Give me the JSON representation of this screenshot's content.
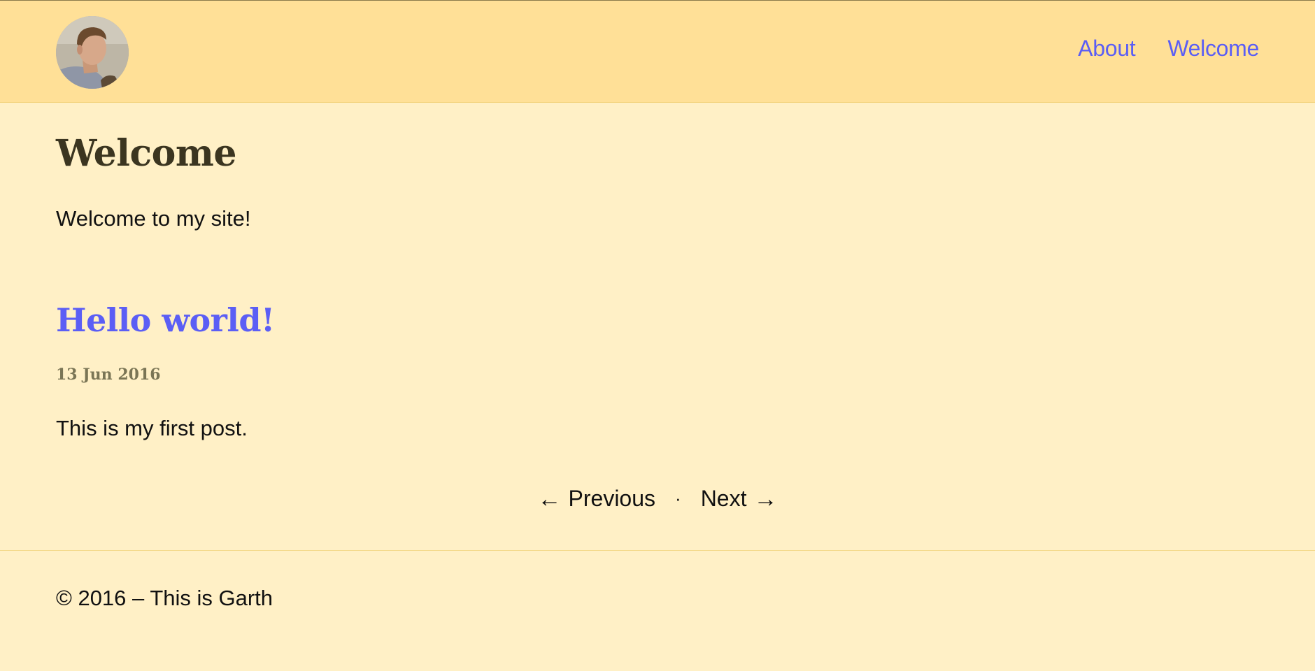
{
  "header": {
    "nav": [
      {
        "label": "About"
      },
      {
        "label": "Welcome"
      }
    ]
  },
  "main": {
    "title": "Welcome",
    "intro": "Welcome to my site!",
    "post": {
      "title": "Hello world!",
      "date": "13 Jun 2016",
      "body": "This is my first post."
    },
    "pager": {
      "previous_arrow": "←",
      "previous_label": "Previous",
      "separator": "·",
      "next_label": "Next",
      "next_arrow": "→"
    }
  },
  "footer": {
    "text": "© 2016 – This is Garth"
  },
  "colors": {
    "header_bg": "#ffe097",
    "page_bg": "#fff0c6",
    "link": "#5b5ef5",
    "heading": "#3b3520",
    "date": "#7a7555"
  },
  "icons": {
    "avatar": "avatar-photo"
  }
}
